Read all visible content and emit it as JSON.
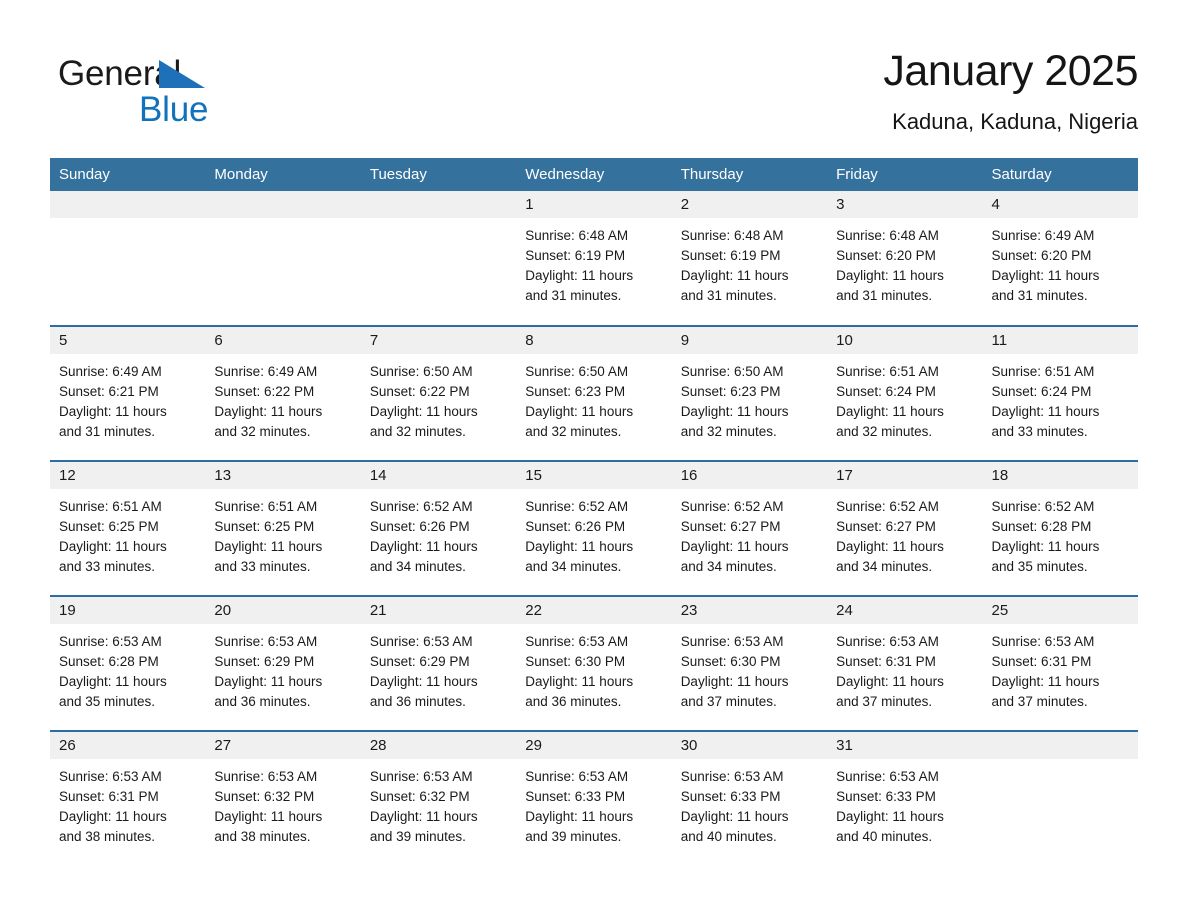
{
  "brand": {
    "name_part1": "General",
    "name_part2": "Blue",
    "triangle_color": "#1e71b8",
    "blue_color": "#1272bb"
  },
  "header": {
    "title": "January 2025",
    "location": "Kaduna, Kaduna, Nigeria"
  },
  "theme": {
    "header_bg": "#35719d",
    "row_border": "#2e6da4",
    "daynum_bg": "#f0f0f0"
  },
  "weekday_headers": [
    "Sunday",
    "Monday",
    "Tuesday",
    "Wednesday",
    "Thursday",
    "Friday",
    "Saturday"
  ],
  "weeks": [
    [
      {
        "day": "",
        "lines": []
      },
      {
        "day": "",
        "lines": []
      },
      {
        "day": "",
        "lines": []
      },
      {
        "day": "1",
        "lines": [
          "Sunrise: 6:48 AM",
          "Sunset: 6:19 PM",
          "Daylight: 11 hours",
          "and 31 minutes."
        ]
      },
      {
        "day": "2",
        "lines": [
          "Sunrise: 6:48 AM",
          "Sunset: 6:19 PM",
          "Daylight: 11 hours",
          "and 31 minutes."
        ]
      },
      {
        "day": "3",
        "lines": [
          "Sunrise: 6:48 AM",
          "Sunset: 6:20 PM",
          "Daylight: 11 hours",
          "and 31 minutes."
        ]
      },
      {
        "day": "4",
        "lines": [
          "Sunrise: 6:49 AM",
          "Sunset: 6:20 PM",
          "Daylight: 11 hours",
          "and 31 minutes."
        ]
      }
    ],
    [
      {
        "day": "5",
        "lines": [
          "Sunrise: 6:49 AM",
          "Sunset: 6:21 PM",
          "Daylight: 11 hours",
          "and 31 minutes."
        ]
      },
      {
        "day": "6",
        "lines": [
          "Sunrise: 6:49 AM",
          "Sunset: 6:22 PM",
          "Daylight: 11 hours",
          "and 32 minutes."
        ]
      },
      {
        "day": "7",
        "lines": [
          "Sunrise: 6:50 AM",
          "Sunset: 6:22 PM",
          "Daylight: 11 hours",
          "and 32 minutes."
        ]
      },
      {
        "day": "8",
        "lines": [
          "Sunrise: 6:50 AM",
          "Sunset: 6:23 PM",
          "Daylight: 11 hours",
          "and 32 minutes."
        ]
      },
      {
        "day": "9",
        "lines": [
          "Sunrise: 6:50 AM",
          "Sunset: 6:23 PM",
          "Daylight: 11 hours",
          "and 32 minutes."
        ]
      },
      {
        "day": "10",
        "lines": [
          "Sunrise: 6:51 AM",
          "Sunset: 6:24 PM",
          "Daylight: 11 hours",
          "and 32 minutes."
        ]
      },
      {
        "day": "11",
        "lines": [
          "Sunrise: 6:51 AM",
          "Sunset: 6:24 PM",
          "Daylight: 11 hours",
          "and 33 minutes."
        ]
      }
    ],
    [
      {
        "day": "12",
        "lines": [
          "Sunrise: 6:51 AM",
          "Sunset: 6:25 PM",
          "Daylight: 11 hours",
          "and 33 minutes."
        ]
      },
      {
        "day": "13",
        "lines": [
          "Sunrise: 6:51 AM",
          "Sunset: 6:25 PM",
          "Daylight: 11 hours",
          "and 33 minutes."
        ]
      },
      {
        "day": "14",
        "lines": [
          "Sunrise: 6:52 AM",
          "Sunset: 6:26 PM",
          "Daylight: 11 hours",
          "and 34 minutes."
        ]
      },
      {
        "day": "15",
        "lines": [
          "Sunrise: 6:52 AM",
          "Sunset: 6:26 PM",
          "Daylight: 11 hours",
          "and 34 minutes."
        ]
      },
      {
        "day": "16",
        "lines": [
          "Sunrise: 6:52 AM",
          "Sunset: 6:27 PM",
          "Daylight: 11 hours",
          "and 34 minutes."
        ]
      },
      {
        "day": "17",
        "lines": [
          "Sunrise: 6:52 AM",
          "Sunset: 6:27 PM",
          "Daylight: 11 hours",
          "and 34 minutes."
        ]
      },
      {
        "day": "18",
        "lines": [
          "Sunrise: 6:52 AM",
          "Sunset: 6:28 PM",
          "Daylight: 11 hours",
          "and 35 minutes."
        ]
      }
    ],
    [
      {
        "day": "19",
        "lines": [
          "Sunrise: 6:53 AM",
          "Sunset: 6:28 PM",
          "Daylight: 11 hours",
          "and 35 minutes."
        ]
      },
      {
        "day": "20",
        "lines": [
          "Sunrise: 6:53 AM",
          "Sunset: 6:29 PM",
          "Daylight: 11 hours",
          "and 36 minutes."
        ]
      },
      {
        "day": "21",
        "lines": [
          "Sunrise: 6:53 AM",
          "Sunset: 6:29 PM",
          "Daylight: 11 hours",
          "and 36 minutes."
        ]
      },
      {
        "day": "22",
        "lines": [
          "Sunrise: 6:53 AM",
          "Sunset: 6:30 PM",
          "Daylight: 11 hours",
          "and 36 minutes."
        ]
      },
      {
        "day": "23",
        "lines": [
          "Sunrise: 6:53 AM",
          "Sunset: 6:30 PM",
          "Daylight: 11 hours",
          "and 37 minutes."
        ]
      },
      {
        "day": "24",
        "lines": [
          "Sunrise: 6:53 AM",
          "Sunset: 6:31 PM",
          "Daylight: 11 hours",
          "and 37 minutes."
        ]
      },
      {
        "day": "25",
        "lines": [
          "Sunrise: 6:53 AM",
          "Sunset: 6:31 PM",
          "Daylight: 11 hours",
          "and 37 minutes."
        ]
      }
    ],
    [
      {
        "day": "26",
        "lines": [
          "Sunrise: 6:53 AM",
          "Sunset: 6:31 PM",
          "Daylight: 11 hours",
          "and 38 minutes."
        ]
      },
      {
        "day": "27",
        "lines": [
          "Sunrise: 6:53 AM",
          "Sunset: 6:32 PM",
          "Daylight: 11 hours",
          "and 38 minutes."
        ]
      },
      {
        "day": "28",
        "lines": [
          "Sunrise: 6:53 AM",
          "Sunset: 6:32 PM",
          "Daylight: 11 hours",
          "and 39 minutes."
        ]
      },
      {
        "day": "29",
        "lines": [
          "Sunrise: 6:53 AM",
          "Sunset: 6:33 PM",
          "Daylight: 11 hours",
          "and 39 minutes."
        ]
      },
      {
        "day": "30",
        "lines": [
          "Sunrise: 6:53 AM",
          "Sunset: 6:33 PM",
          "Daylight: 11 hours",
          "and 40 minutes."
        ]
      },
      {
        "day": "31",
        "lines": [
          "Sunrise: 6:53 AM",
          "Sunset: 6:33 PM",
          "Daylight: 11 hours",
          "and 40 minutes."
        ]
      },
      {
        "day": "",
        "lines": []
      }
    ]
  ]
}
